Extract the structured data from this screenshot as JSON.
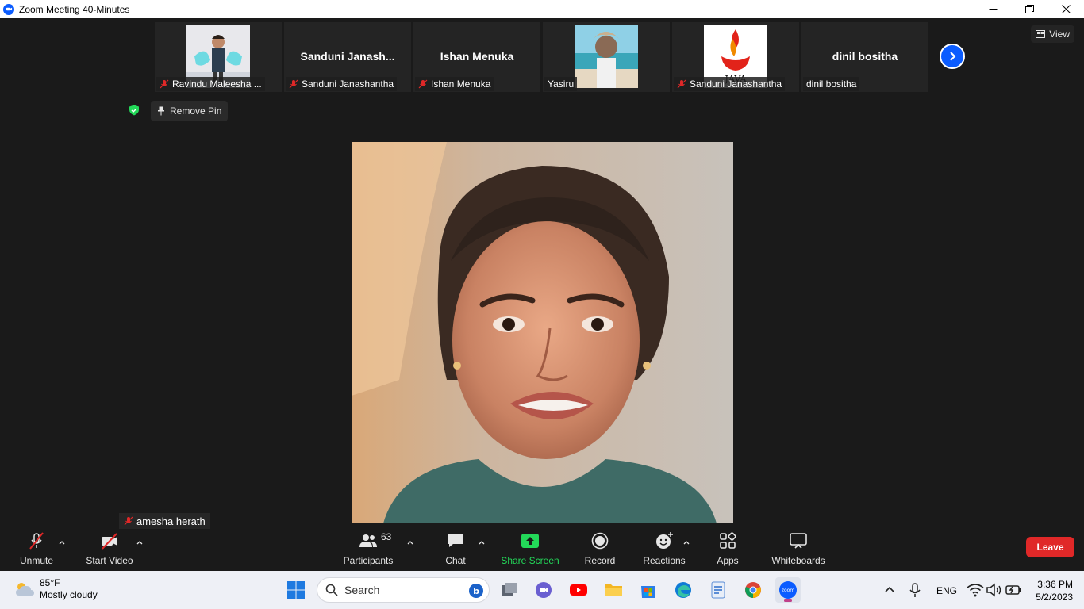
{
  "window": {
    "title": "Zoom Meeting 40-Minutes"
  },
  "header": {
    "view_label": "View",
    "remove_pin_label": "Remove Pin"
  },
  "thumbnails": [
    {
      "display": "photo",
      "label": "Ravindu Maleesha ...",
      "muted": true
    },
    {
      "display": "name",
      "big_name": "Sanduni  Janash...",
      "label": "Sanduni Janashantha",
      "muted": true
    },
    {
      "display": "name",
      "big_name": "Ishan Menuka",
      "label": "Ishan Menuka",
      "muted": true
    },
    {
      "display": "photo",
      "label": "Yasiru",
      "muted": false
    },
    {
      "display": "photo",
      "label": "Sanduni Janashantha",
      "muted": true,
      "logo_text": "JAVA"
    },
    {
      "display": "name",
      "big_name": "dinil bositha",
      "label": "dinil bositha",
      "muted": false
    }
  ],
  "main": {
    "speaker_label": "amesha herath",
    "speaker_muted": true
  },
  "toolbar": {
    "unmute": "Unmute",
    "start_video": "Start Video",
    "participants": "Participants",
    "participants_count": "63",
    "chat": "Chat",
    "share_screen": "Share Screen",
    "record": "Record",
    "reactions": "Reactions",
    "apps": "Apps",
    "whiteboards": "Whiteboards",
    "leave": "Leave"
  },
  "taskbar": {
    "weather_temp": "85°F",
    "weather_desc": "Mostly cloudy",
    "search_placeholder": "Search",
    "zoom_icon_text": "zoom",
    "language": "ENG",
    "time": "3:36 PM",
    "date": "5/2/2023"
  },
  "colors": {
    "accent": "#0b5cff",
    "share_green": "#23d959",
    "leave_red": "#e02828",
    "muted_red": "#e02828"
  }
}
